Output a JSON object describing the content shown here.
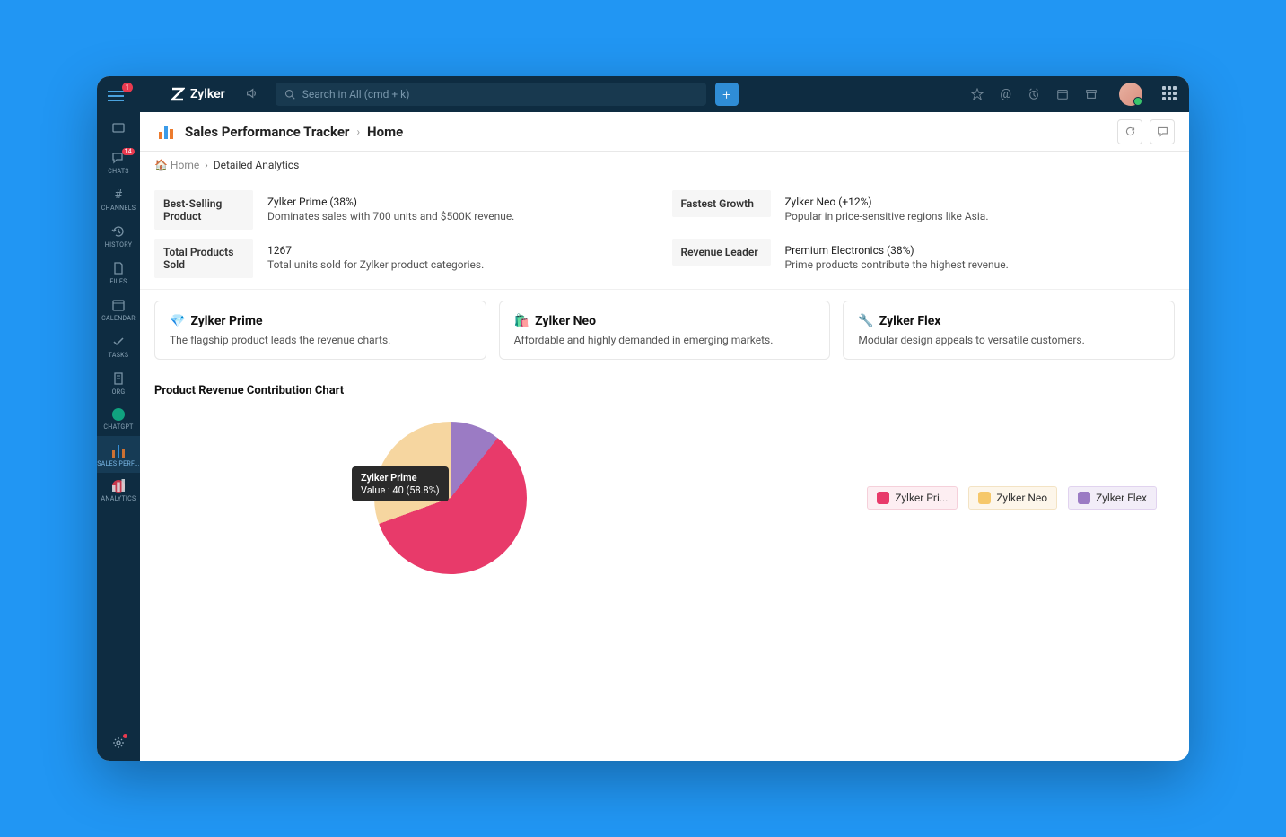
{
  "brand": "Zylker",
  "search": {
    "placeholder": "Search in All (cmd + k)"
  },
  "hamburger_badge": "1",
  "sidebar": {
    "items": [
      {
        "label": ""
      },
      {
        "label": "CHATS",
        "badge": "14"
      },
      {
        "label": "CHANNELS"
      },
      {
        "label": "HISTORY"
      },
      {
        "label": "FILES"
      },
      {
        "label": "CALENDAR"
      },
      {
        "label": "TASKS"
      },
      {
        "label": "ORG"
      },
      {
        "label": "CHATGPT"
      },
      {
        "label": "SALES PERF..."
      },
      {
        "label": "ANALYTICS"
      }
    ]
  },
  "header": {
    "title": "Sales Performance Tracker",
    "page": "Home"
  },
  "breadcrumb": {
    "home": "Home",
    "current": "Detailed Analytics"
  },
  "stats": [
    {
      "label": "Best-Selling Product",
      "line1": "Zylker Prime (38%)",
      "line2": "Dominates sales with 700 units and $500K revenue."
    },
    {
      "label": "Fastest Growth",
      "line1": "Zylker Neo (+12%)",
      "line2": "Popular in price-sensitive regions like Asia."
    },
    {
      "label": "Total Products Sold",
      "line1": "1267",
      "line2": "Total units sold for Zylker product categories."
    },
    {
      "label": "Revenue Leader",
      "line1": "Premium Electronics (38%)",
      "line2": "Prime products contribute the highest revenue."
    }
  ],
  "products": [
    {
      "emoji": "💎",
      "title": "Zylker Prime",
      "desc": "The flagship product leads the revenue charts."
    },
    {
      "emoji": "🛍️",
      "title": "Zylker Neo",
      "desc": "Affordable and highly demanded in emerging markets."
    },
    {
      "emoji": "🔧",
      "title": "Zylker Flex",
      "desc": "Modular design appeals to versatile customers."
    }
  ],
  "chart_title": "Product Revenue Contribution Chart",
  "tooltip": {
    "name": "Zylker Prime",
    "value": "Value : 40 (58.8%)"
  },
  "legend": [
    {
      "label": "Zylker Pri...",
      "color": "#e83a6a"
    },
    {
      "label": "Zylker Neo",
      "color": "#f6c86a"
    },
    {
      "label": "Zylker Flex",
      "color": "#9b7bc4"
    }
  ],
  "chart_data": {
    "type": "pie",
    "title": "Product Revenue Contribution Chart",
    "series": [
      {
        "name": "Zylker Prime",
        "value": 40,
        "percent": 58.8,
        "color": "#e83a6a"
      },
      {
        "name": "Zylker Neo",
        "value": 21,
        "percent": 30.6,
        "color": "#f6d6a0"
      },
      {
        "name": "Zylker Flex",
        "value": 7,
        "percent": 10.6,
        "color": "#9b7bc4"
      }
    ]
  }
}
